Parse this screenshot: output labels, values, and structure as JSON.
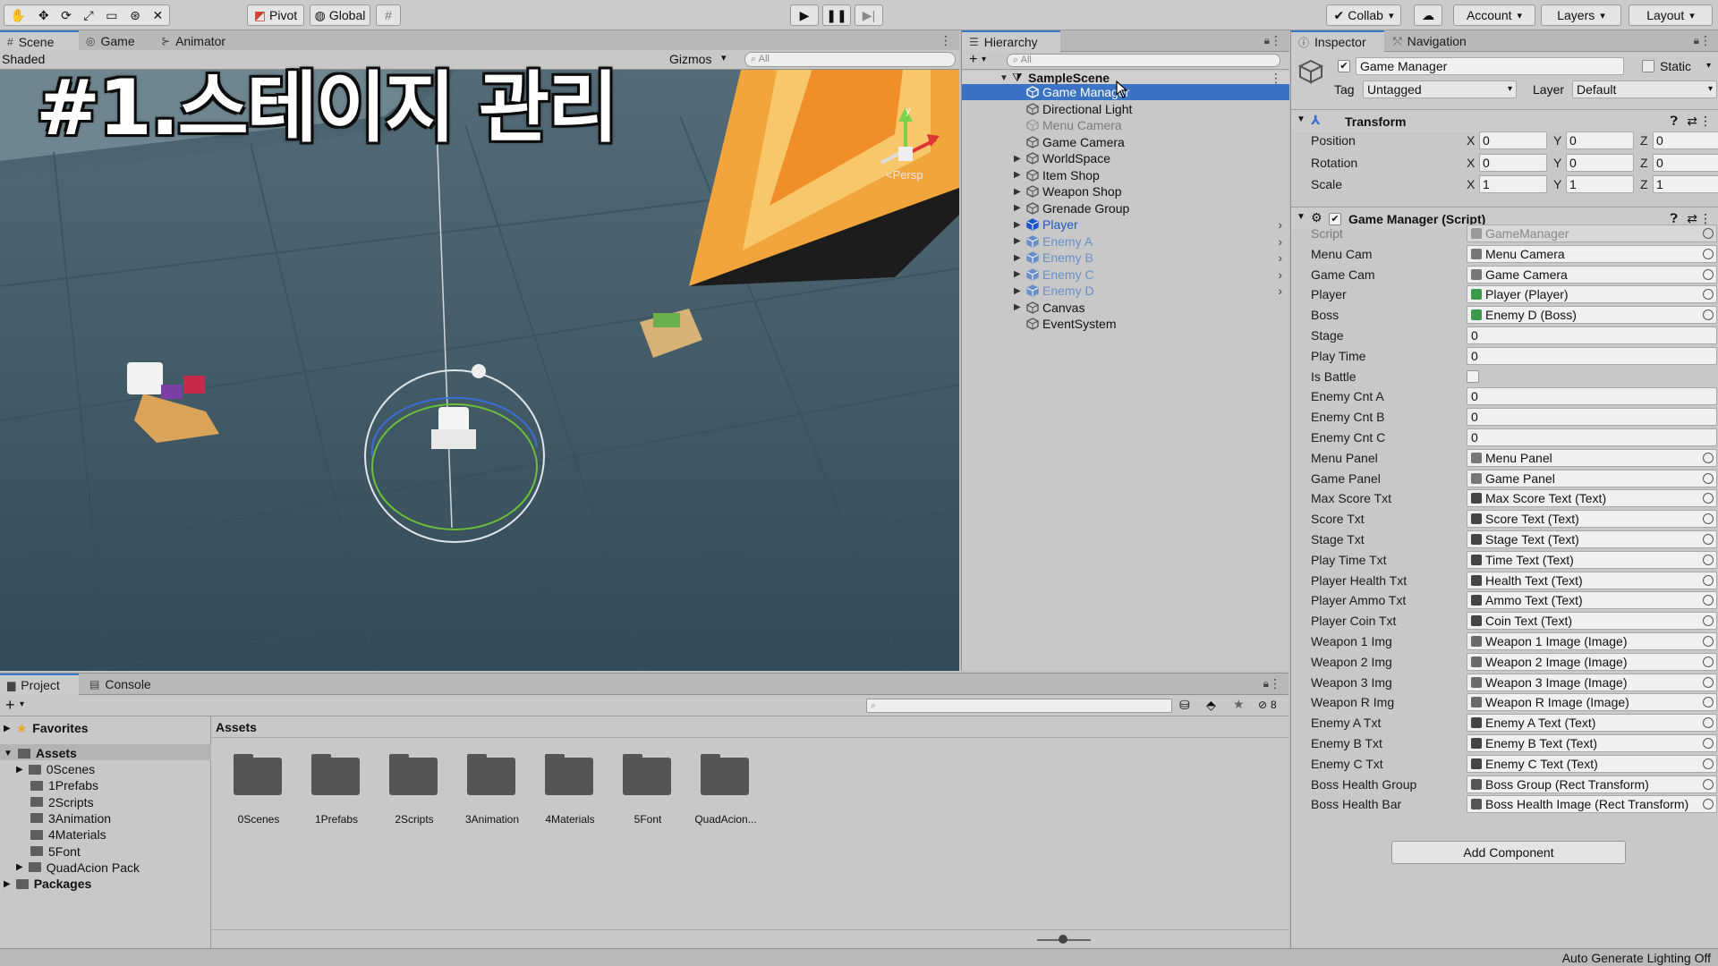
{
  "toolbar": {
    "pivot_label": "Pivot",
    "global_label": "Global",
    "collab_label": "Collab",
    "account_label": "Account",
    "layers_label": "Layers",
    "layout_label": "Layout"
  },
  "scene_panel": {
    "tabs": [
      "Scene",
      "Game",
      "Animator"
    ],
    "shading_mode": "Shaded",
    "gizmos_label": "Gizmos",
    "search_placeholder": "All",
    "overlay_title": "#1.스테이지 관리",
    "persp_label": "<Persp"
  },
  "hierarchy": {
    "tab_label": "Hierarchy",
    "search_placeholder": "All",
    "scene_name": "SampleScene",
    "items": [
      {
        "label": "Game Manager",
        "selected": true,
        "expandable": false,
        "kind": "normal"
      },
      {
        "label": "Directional Light",
        "expandable": false,
        "kind": "normal"
      },
      {
        "label": "Menu Camera",
        "expandable": false,
        "kind": "disabled"
      },
      {
        "label": "Game Camera",
        "expandable": false,
        "kind": "normal"
      },
      {
        "label": "WorldSpace",
        "expandable": true,
        "kind": "normal"
      },
      {
        "label": "Item Shop",
        "expandable": true,
        "kind": "normal"
      },
      {
        "label": "Weapon Shop",
        "expandable": true,
        "kind": "normal"
      },
      {
        "label": "Grenade Group",
        "expandable": true,
        "kind": "normal"
      },
      {
        "label": "Player",
        "expandable": true,
        "kind": "prefab"
      },
      {
        "label": "Enemy A",
        "expandable": true,
        "kind": "prefab-disabled"
      },
      {
        "label": "Enemy B",
        "expandable": true,
        "kind": "prefab-disabled"
      },
      {
        "label": "Enemy C",
        "expandable": true,
        "kind": "prefab-disabled"
      },
      {
        "label": "Enemy D",
        "expandable": true,
        "kind": "prefab-disabled"
      },
      {
        "label": "Canvas",
        "expandable": true,
        "kind": "normal"
      },
      {
        "label": "EventSystem",
        "expandable": false,
        "kind": "normal"
      }
    ]
  },
  "inspector": {
    "tabs": [
      "Inspector",
      "Navigation"
    ],
    "object_name": "Game Manager",
    "static_label": "Static",
    "tag_label": "Tag",
    "tag_value": "Untagged",
    "layer_label": "Layer",
    "layer_value": "Default",
    "transform": {
      "title": "Transform",
      "position_label": "Position",
      "rotation_label": "Rotation",
      "scale_label": "Scale",
      "position": [
        "0",
        "0",
        "0"
      ],
      "rotation": [
        "0",
        "0",
        "0"
      ],
      "scale": [
        "1",
        "1",
        "1"
      ],
      "axis_labels": [
        "X",
        "Y",
        "Z"
      ]
    },
    "script_component": {
      "title": "Game Manager (Script)",
      "fields": [
        {
          "label": "Script",
          "value": "GameManager",
          "type": "script"
        },
        {
          "label": "Menu Cam",
          "value": "Menu Camera",
          "type": "gameobject"
        },
        {
          "label": "Game Cam",
          "value": "Game Camera",
          "type": "gameobject"
        },
        {
          "label": "Player",
          "value": "Player (Player)",
          "type": "component"
        },
        {
          "label": "Boss",
          "value": "Enemy D (Boss)",
          "type": "component"
        },
        {
          "label": "Stage",
          "value": "0",
          "type": "number"
        },
        {
          "label": "Play Time",
          "value": "0",
          "type": "number"
        },
        {
          "label": "Is Battle",
          "value": "",
          "type": "checkbox"
        },
        {
          "label": "Enemy Cnt A",
          "value": "0",
          "type": "number"
        },
        {
          "label": "Enemy Cnt B",
          "value": "0",
          "type": "number"
        },
        {
          "label": "Enemy Cnt C",
          "value": "0",
          "type": "number"
        },
        {
          "label": "Menu Panel",
          "value": "Menu Panel",
          "type": "gameobject"
        },
        {
          "label": "Game Panel",
          "value": "Game Panel",
          "type": "gameobject"
        },
        {
          "label": "Max Score Txt",
          "value": "Max Score Text (Text)",
          "type": "text"
        },
        {
          "label": "Score Txt",
          "value": "Score Text (Text)",
          "type": "text"
        },
        {
          "label": "Stage Txt",
          "value": "Stage Text (Text)",
          "type": "text"
        },
        {
          "label": "Play Time Txt",
          "value": "Time Text (Text)",
          "type": "text"
        },
        {
          "label": "Player Health Txt",
          "value": "Health Text (Text)",
          "type": "text"
        },
        {
          "label": "Player Ammo Txt",
          "value": "Ammo Text (Text)",
          "type": "text"
        },
        {
          "label": "Player Coin Txt",
          "value": "Coin Text (Text)",
          "type": "text"
        },
        {
          "label": "Weapon 1 Img",
          "value": "Weapon 1 Image (Image)",
          "type": "image"
        },
        {
          "label": "Weapon 2 Img",
          "value": "Weapon 2 Image (Image)",
          "type": "image"
        },
        {
          "label": "Weapon 3 Img",
          "value": "Weapon 3 Image (Image)",
          "type": "image"
        },
        {
          "label": "Weapon R Img",
          "value": "Weapon R Image (Image)",
          "type": "image"
        },
        {
          "label": "Enemy A Txt",
          "value": "Enemy A Text (Text)",
          "type": "text"
        },
        {
          "label": "Enemy B Txt",
          "value": "Enemy B Text (Text)",
          "type": "text"
        },
        {
          "label": "Enemy C Txt",
          "value": "Enemy C Text (Text)",
          "type": "text"
        },
        {
          "label": "Boss Health Group",
          "value": "Boss Group (Rect Transform)",
          "type": "rect"
        },
        {
          "label": "Boss Health Bar",
          "value": "Boss Health Image (Rect Transform)",
          "type": "rect"
        }
      ]
    },
    "add_component_label": "Add Component"
  },
  "project": {
    "tabs": [
      "Project",
      "Console"
    ],
    "favorites_label": "Favorites",
    "assets_label": "Assets",
    "packages_label": "Packages",
    "tree": [
      "0Scenes",
      "1Prefabs",
      "2Scripts",
      "3Animation",
      "4Materials",
      "5Font",
      "QuadAcion Pack"
    ],
    "breadcrumb": "Assets",
    "folders": [
      "0Scenes",
      "1Prefabs",
      "2Scripts",
      "3Animation",
      "4Materials",
      "5Font",
      "QuadAcion..."
    ],
    "hidden_count": "8"
  },
  "status": {
    "right_text": "Auto Generate Lighting Off"
  },
  "colors": {
    "selection": "#3a72c4",
    "prefab_blue": "#1a55c8",
    "prefab_disabled": "#6a8fc8",
    "disabled_text": "#7b7b7b",
    "scene_floor": "#3f5a66"
  }
}
